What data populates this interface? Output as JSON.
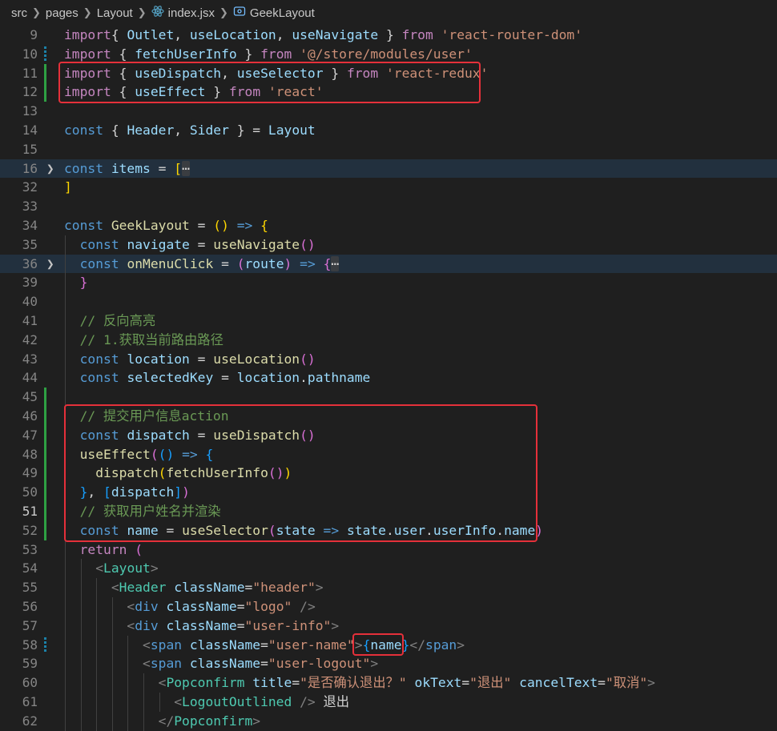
{
  "breadcrumb": {
    "segments": [
      "src",
      "pages",
      "Layout",
      "index.jsx",
      "GeekLayout"
    ],
    "separator_icon": "chevron-right-icon",
    "file_icon": "react-icon",
    "symbol_icon": "component-icon"
  },
  "colors": {
    "background": "#1f1f1f",
    "highlight_box": "#e5303a",
    "git_added": "#2ea043",
    "git_modified": "#1b81a8"
  },
  "editor": {
    "language": "jsx",
    "lines": [
      {
        "num": "9",
        "segments": [
          [
            "imp",
            "import"
          ],
          [
            "",
            "{ "
          ],
          [
            "var",
            "Outlet"
          ],
          [
            "",
            ", "
          ],
          [
            "var",
            "useLocation"
          ],
          [
            "",
            ", "
          ],
          [
            "var",
            "useNavigate"
          ],
          [
            "",
            " } "
          ],
          [
            "imp",
            "from"
          ],
          [
            "",
            " "
          ],
          [
            "str",
            "'react-router-dom'"
          ]
        ]
      },
      {
        "num": "10",
        "segments": [
          [
            "imp",
            "import"
          ],
          [
            "",
            " { "
          ],
          [
            "var",
            "fetchUserInfo"
          ],
          [
            "",
            " } "
          ],
          [
            "imp",
            "from"
          ],
          [
            "",
            " "
          ],
          [
            "str",
            "'@/store/modules/user'"
          ]
        ]
      },
      {
        "num": "11",
        "segments": [
          [
            "imp",
            "import"
          ],
          [
            "",
            " { "
          ],
          [
            "var",
            "useDispatch"
          ],
          [
            "",
            ", "
          ],
          [
            "var",
            "useSelector"
          ],
          [
            "",
            " } "
          ],
          [
            "imp",
            "from"
          ],
          [
            "",
            " "
          ],
          [
            "str",
            "'react-redux'"
          ]
        ]
      },
      {
        "num": "12",
        "segments": [
          [
            "imp",
            "import"
          ],
          [
            "",
            " { "
          ],
          [
            "var",
            "useEffect"
          ],
          [
            "",
            " } "
          ],
          [
            "imp",
            "from"
          ],
          [
            "",
            " "
          ],
          [
            "str",
            "'react'"
          ]
        ]
      },
      {
        "num": "13",
        "segments": []
      },
      {
        "num": "14",
        "segments": [
          [
            "kw",
            "const"
          ],
          [
            "",
            " { "
          ],
          [
            "var",
            "Header"
          ],
          [
            "",
            ", "
          ],
          [
            "var",
            "Sider"
          ],
          [
            "",
            " } = "
          ],
          [
            "var",
            "Layout"
          ]
        ]
      },
      {
        "num": "15",
        "segments": []
      },
      {
        "num": "16",
        "segments": [
          [
            "kw",
            "const"
          ],
          [
            "",
            " "
          ],
          [
            "var",
            "items"
          ],
          [
            "",
            " = "
          ],
          [
            "b1",
            "["
          ],
          [
            "fe",
            "⋯"
          ]
        ]
      },
      {
        "num": "32",
        "segments": [
          [
            "b1",
            "]"
          ]
        ]
      },
      {
        "num": "33",
        "segments": []
      },
      {
        "num": "34",
        "segments": [
          [
            "kw",
            "const"
          ],
          [
            "",
            " "
          ],
          [
            "fn",
            "GeekLayout"
          ],
          [
            "",
            " = "
          ],
          [
            "b1",
            "()"
          ],
          [
            "",
            " "
          ],
          [
            "kw",
            "=>"
          ],
          [
            "",
            " "
          ],
          [
            "b1",
            "{"
          ]
        ]
      },
      {
        "num": "35",
        "segments": [
          [
            "",
            "  "
          ],
          [
            "kw",
            "const"
          ],
          [
            "",
            " "
          ],
          [
            "var",
            "navigate"
          ],
          [
            "",
            " = "
          ],
          [
            "fn",
            "useNavigate"
          ],
          [
            "b2",
            "()"
          ]
        ]
      },
      {
        "num": "36",
        "segments": [
          [
            "",
            "  "
          ],
          [
            "kw",
            "const"
          ],
          [
            "",
            " "
          ],
          [
            "fn",
            "onMenuClick"
          ],
          [
            "",
            " = "
          ],
          [
            "b2",
            "("
          ],
          [
            "var",
            "route"
          ],
          [
            "b2",
            ")"
          ],
          [
            "",
            " "
          ],
          [
            "kw",
            "=>"
          ],
          [
            "",
            " "
          ],
          [
            "b2",
            "{"
          ],
          [
            "fe",
            "⋯"
          ]
        ]
      },
      {
        "num": "39",
        "segments": [
          [
            "",
            "  "
          ],
          [
            "b2",
            "}"
          ]
        ]
      },
      {
        "num": "40",
        "segments": []
      },
      {
        "num": "41",
        "segments": [
          [
            "",
            "  "
          ],
          [
            "cmt",
            "// 反向高亮"
          ]
        ]
      },
      {
        "num": "42",
        "segments": [
          [
            "",
            "  "
          ],
          [
            "cmt",
            "// 1.获取当前路由路径"
          ]
        ]
      },
      {
        "num": "43",
        "segments": [
          [
            "",
            "  "
          ],
          [
            "kw",
            "const"
          ],
          [
            "",
            " "
          ],
          [
            "var",
            "location"
          ],
          [
            "",
            " = "
          ],
          [
            "fn",
            "useLocation"
          ],
          [
            "b2",
            "()"
          ]
        ]
      },
      {
        "num": "44",
        "segments": [
          [
            "",
            "  "
          ],
          [
            "kw",
            "const"
          ],
          [
            "",
            " "
          ],
          [
            "var",
            "selectedKey"
          ],
          [
            "",
            " = "
          ],
          [
            "var",
            "location"
          ],
          [
            "",
            "."
          ],
          [
            "var",
            "pathname"
          ]
        ]
      },
      {
        "num": "45",
        "segments": []
      },
      {
        "num": "46",
        "segments": [
          [
            "",
            "  "
          ],
          [
            "cmt",
            "// 提交用户信息action"
          ]
        ]
      },
      {
        "num": "47",
        "segments": [
          [
            "",
            "  "
          ],
          [
            "kw",
            "const"
          ],
          [
            "",
            " "
          ],
          [
            "var",
            "dispatch"
          ],
          [
            "",
            " = "
          ],
          [
            "fn",
            "useDispatch"
          ],
          [
            "b2",
            "()"
          ]
        ]
      },
      {
        "num": "48",
        "segments": [
          [
            "",
            "  "
          ],
          [
            "fn",
            "useEffect"
          ],
          [
            "b2",
            "("
          ],
          [
            "b3",
            "()"
          ],
          [
            "",
            " "
          ],
          [
            "kw",
            "=>"
          ],
          [
            "",
            " "
          ],
          [
            "b3",
            "{"
          ]
        ]
      },
      {
        "num": "49",
        "segments": [
          [
            "",
            "    "
          ],
          [
            "fn",
            "dispatch"
          ],
          [
            "b1",
            "("
          ],
          [
            "fn",
            "fetchUserInfo"
          ],
          [
            "b2",
            "()"
          ],
          [
            "b1",
            ")"
          ]
        ]
      },
      {
        "num": "50",
        "segments": [
          [
            "",
            "  "
          ],
          [
            "b3",
            "}"
          ],
          [
            "",
            ", "
          ],
          [
            "b3",
            "["
          ],
          [
            "var",
            "dispatch"
          ],
          [
            "b3",
            "]"
          ],
          [
            "b2",
            ")"
          ]
        ]
      },
      {
        "num": "51",
        "segments": [
          [
            "",
            "  "
          ],
          [
            "cmt",
            "// 获取用户姓名并渲染"
          ]
        ]
      },
      {
        "num": "52",
        "segments": [
          [
            "",
            "  "
          ],
          [
            "kw",
            "const"
          ],
          [
            "",
            " "
          ],
          [
            "var",
            "name"
          ],
          [
            "",
            " = "
          ],
          [
            "fn",
            "useSelector"
          ],
          [
            "b2",
            "("
          ],
          [
            "var",
            "state"
          ],
          [
            "",
            " "
          ],
          [
            "kw",
            "=>"
          ],
          [
            "",
            " "
          ],
          [
            "var",
            "state"
          ],
          [
            "",
            "."
          ],
          [
            "var",
            "user"
          ],
          [
            "",
            "."
          ],
          [
            "var",
            "userInfo"
          ],
          [
            "",
            "."
          ],
          [
            "var",
            "name"
          ],
          [
            "b2",
            ")"
          ]
        ]
      },
      {
        "num": "53",
        "segments": [
          [
            "",
            "  "
          ],
          [
            "imp",
            "return"
          ],
          [
            "",
            " "
          ],
          [
            "b2",
            "("
          ]
        ]
      },
      {
        "num": "54",
        "segments": [
          [
            "",
            "    "
          ],
          [
            "punc",
            "<"
          ],
          [
            "cls",
            "Layout"
          ],
          [
            "punc",
            ">"
          ]
        ]
      },
      {
        "num": "55",
        "segments": [
          [
            "",
            "      "
          ],
          [
            "punc",
            "<"
          ],
          [
            "cls",
            "Header"
          ],
          [
            "",
            " "
          ],
          [
            "var",
            "className"
          ],
          [
            "",
            "="
          ],
          [
            "str",
            "\"header\""
          ],
          [
            "punc",
            ">"
          ]
        ]
      },
      {
        "num": "56",
        "segments": [
          [
            "",
            "        "
          ],
          [
            "punc",
            "<"
          ],
          [
            "tag",
            "div"
          ],
          [
            "",
            " "
          ],
          [
            "var",
            "className"
          ],
          [
            "",
            "="
          ],
          [
            "str",
            "\"logo\""
          ],
          [
            "",
            " "
          ],
          [
            "punc",
            "/>"
          ]
        ]
      },
      {
        "num": "57",
        "segments": [
          [
            "",
            "        "
          ],
          [
            "punc",
            "<"
          ],
          [
            "tag",
            "div"
          ],
          [
            "",
            " "
          ],
          [
            "var",
            "className"
          ],
          [
            "",
            "="
          ],
          [
            "str",
            "\"user-info\""
          ],
          [
            "punc",
            ">"
          ]
        ]
      },
      {
        "num": "58",
        "segments": [
          [
            "",
            "          "
          ],
          [
            "punc",
            "<"
          ],
          [
            "tag",
            "span"
          ],
          [
            "",
            " "
          ],
          [
            "var",
            "className"
          ],
          [
            "",
            "="
          ],
          [
            "str",
            "\"user-name\""
          ],
          [
            "punc",
            ">"
          ],
          [
            "b3",
            "{"
          ],
          [
            "var",
            "name"
          ],
          [
            "b3",
            "}"
          ],
          [
            "punc",
            "</"
          ],
          [
            "tag",
            "span"
          ],
          [
            "punc",
            ">"
          ]
        ]
      },
      {
        "num": "59",
        "segments": [
          [
            "",
            "          "
          ],
          [
            "punc",
            "<"
          ],
          [
            "tag",
            "span"
          ],
          [
            "",
            " "
          ],
          [
            "var",
            "className"
          ],
          [
            "",
            "="
          ],
          [
            "str",
            "\"user-logout\""
          ],
          [
            "punc",
            ">"
          ]
        ]
      },
      {
        "num": "60",
        "segments": [
          [
            "",
            "            "
          ],
          [
            "punc",
            "<"
          ],
          [
            "cls",
            "Popconfirm"
          ],
          [
            "",
            " "
          ],
          [
            "var",
            "title"
          ],
          [
            "",
            "="
          ],
          [
            "str",
            "\"是否确认退出？\""
          ],
          [
            "",
            " "
          ],
          [
            "var",
            "okText"
          ],
          [
            "",
            "="
          ],
          [
            "str",
            "\"退出\""
          ],
          [
            "",
            " "
          ],
          [
            "var",
            "cancelText"
          ],
          [
            "",
            "="
          ],
          [
            "str",
            "\"取消\""
          ],
          [
            "punc",
            ">"
          ]
        ]
      },
      {
        "num": "61",
        "segments": [
          [
            "",
            "              "
          ],
          [
            "punc",
            "<"
          ],
          [
            "cls",
            "LogoutOutlined"
          ],
          [
            "",
            " "
          ],
          [
            "punc",
            "/>"
          ],
          [
            "",
            " 退出"
          ]
        ]
      },
      {
        "num": "62",
        "segments": [
          [
            "",
            "            "
          ],
          [
            "punc",
            "</"
          ],
          [
            "cls",
            "Popconfirm"
          ],
          [
            "punc",
            ">"
          ]
        ]
      }
    ]
  }
}
